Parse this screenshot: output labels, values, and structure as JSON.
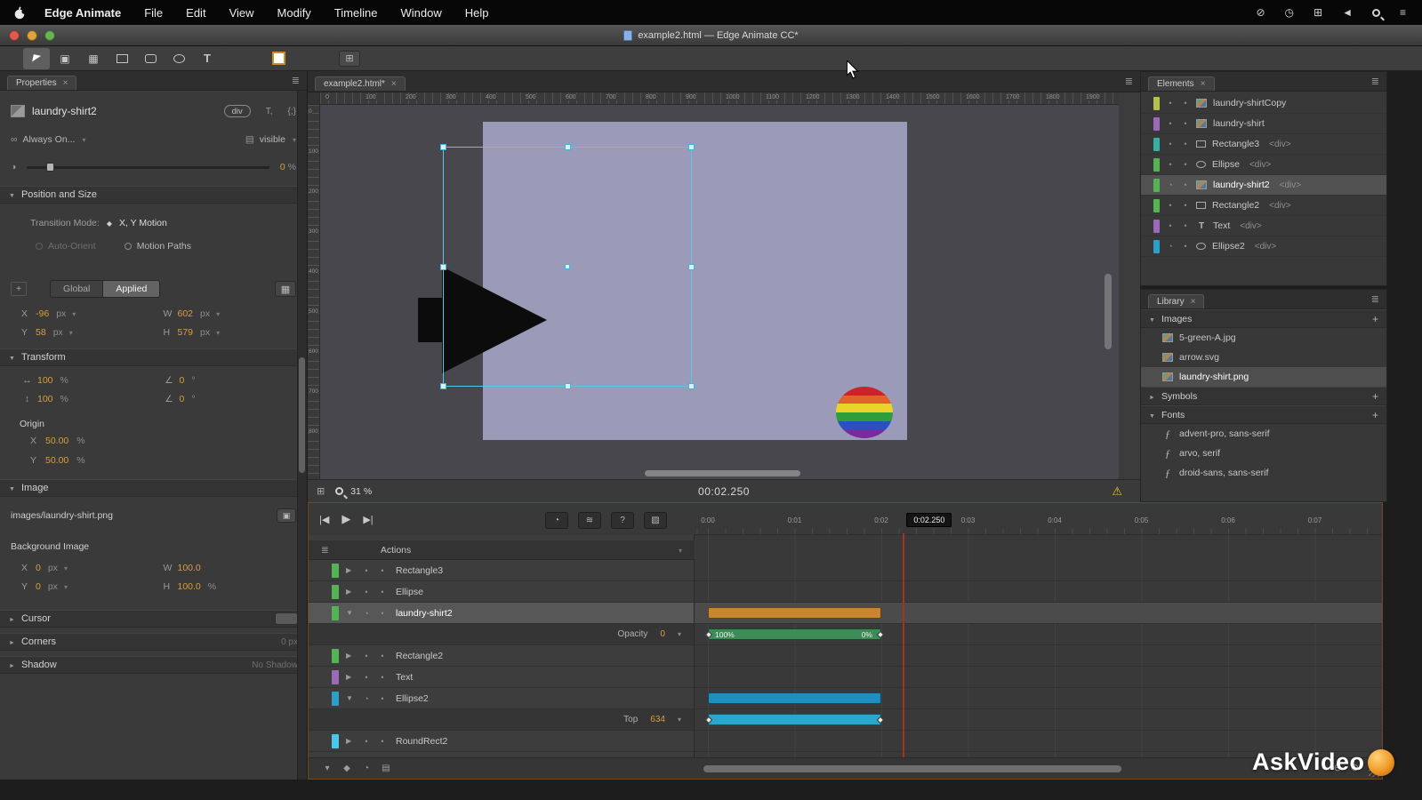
{
  "menubar": {
    "app_name": "Edge Animate",
    "items": [
      "File",
      "Edit",
      "View",
      "Modify",
      "Timeline",
      "Window",
      "Help"
    ],
    "status_icons": [
      "time-machine-icon",
      "clock-icon",
      "displays-icon",
      "volume-icon",
      "spotlight-icon",
      "notification-list-icon"
    ]
  },
  "titlebar": {
    "title": "example2.html — Edge Animate CC*"
  },
  "toolbar": {
    "tools": [
      "select-tool",
      "transform-tool",
      "clip-tool",
      "rectangle-tool",
      "rounded-rect-tool",
      "ellipse-tool",
      "text-tool"
    ]
  },
  "properties": {
    "tab_label": "Properties",
    "element_id": "laundry-shirt2",
    "tag_chip": "div",
    "display_value": "Always On...",
    "overflow_value": "visible",
    "opacity_value": "0",
    "opacity_unit": "%",
    "labels": {
      "x": "X",
      "y": "Y",
      "w": "W",
      "h": "H"
    },
    "position_size": {
      "header": "Position and Size",
      "transition_mode_label": "Transition Mode:",
      "transition_mode_value": "X, Y Motion",
      "auto_orient": "Auto-Orient",
      "motion_paths": "Motion Paths",
      "global": "Global",
      "applied": "Applied",
      "x": "-96",
      "y": "58",
      "w": "602",
      "h": "579",
      "unit": "px"
    },
    "transform": {
      "header": "Transform",
      "scale_x": "100",
      "scale_y": "100",
      "scale_unit": "%",
      "rotate": "0",
      "skew": "0",
      "angle_unit": "°",
      "origin_label": "Origin",
      "origin_x": "50.00",
      "origin_y": "50.00",
      "origin_unit": "%"
    },
    "image": {
      "header": "Image",
      "src": "images/laundry-shirt.png",
      "background_label": "Background Image",
      "x": "0",
      "y": "0",
      "xy_unit": "px",
      "w": "100.0",
      "h": "100.0",
      "h_unit": "%"
    },
    "cursor_header": "Cursor",
    "corners_header": "Corners",
    "corners_value": "0 px",
    "shadow_header": "Shadow",
    "shadow_value": "No Shadow"
  },
  "stage": {
    "tab_label": "example2.html*",
    "zoom": "31 %",
    "timecode": "00:02.250",
    "h_ruler": [
      "0",
      "100",
      "200",
      "300",
      "400",
      "500",
      "600",
      "700",
      "800",
      "900",
      "1000",
      "1100",
      "1200",
      "1300",
      "1400",
      "1500",
      "1600",
      "1700",
      "1800",
      "1900"
    ],
    "v_ruler": [
      "0",
      "100",
      "200",
      "300",
      "400",
      "500",
      "600",
      "700",
      "800"
    ]
  },
  "elements": {
    "tab_label": "Elements",
    "rows": [
      {
        "label": "laundry-shirtCopy",
        "tag": "",
        "chip": "#b4c24a",
        "icon": "image",
        "clock": false,
        "selected": false
      },
      {
        "label": "laundry-shirt",
        "tag": "",
        "chip": "#9a6ab8",
        "icon": "image",
        "clock": false,
        "selected": false
      },
      {
        "label": "Rectangle3",
        "tag": "<div>",
        "chip": "#38b0a0",
        "icon": "rect",
        "clock": false,
        "selected": false
      },
      {
        "label": "Ellipse",
        "tag": "<div>",
        "chip": "#54b454",
        "icon": "ellipse",
        "clock": false,
        "selected": false
      },
      {
        "label": "laundry-shirt2",
        "tag": "<div>",
        "chip": "#54b454",
        "icon": "image",
        "clock": true,
        "selected": true
      },
      {
        "label": "Rectangle2",
        "tag": "<div>",
        "chip": "#54b454",
        "icon": "rect",
        "clock": false,
        "selected": false
      },
      {
        "label": "Text",
        "tag": "<div>",
        "chip": "#9a6ab8",
        "icon": "text",
        "clock": false,
        "selected": false
      },
      {
        "label": "Ellipse2",
        "tag": "<div>",
        "chip": "#2aa0c8",
        "icon": "ellipse",
        "clock": true,
        "selected": false
      }
    ]
  },
  "library": {
    "tab_label": "Library",
    "sections": [
      {
        "label": "Images",
        "expanded": true,
        "items": [
          {
            "name": "5-green-A.jpg",
            "icon": "image",
            "selected": false
          },
          {
            "name": "arrow.svg",
            "icon": "image",
            "selected": false
          },
          {
            "name": "laundry-shirt.png",
            "icon": "image",
            "selected": true
          }
        ]
      },
      {
        "label": "Symbols",
        "expanded": false,
        "items": []
      },
      {
        "label": "Fonts",
        "expanded": true,
        "items": [
          {
            "name": "advent-pro, sans-serif",
            "icon": "font",
            "selected": false
          },
          {
            "name": "arvo, serif",
            "icon": "font",
            "selected": false
          },
          {
            "name": "droid-sans, sans-serif",
            "icon": "font",
            "selected": false
          }
        ]
      }
    ]
  },
  "timeline": {
    "actions_label": "Actions",
    "ruler_labels": [
      "0:00",
      "0:01",
      "0:02",
      "0:03",
      "0:04",
      "0:05",
      "0:06",
      "0:07"
    ],
    "playhead_time": "0:02.250",
    "playhead_seconds": 2.25,
    "rows": [
      {
        "label": "Rectangle3",
        "type": "main",
        "chip": "#54b454",
        "expanded": false,
        "clock": false,
        "selected": false
      },
      {
        "label": "Ellipse",
        "type": "main",
        "chip": "#54b454",
        "expanded": false,
        "clock": false,
        "selected": false
      },
      {
        "label": "laundry-shirt2",
        "type": "main",
        "chip": "#54b454",
        "expanded": true,
        "clock": true,
        "selected": true,
        "bar": {
          "color": "#c8862e",
          "start": 0,
          "end": 2
        }
      },
      {
        "label": "Opacity",
        "type": "sub",
        "value": "0",
        "bar": {
          "color": "#3d8b57",
          "start": 0,
          "end": 2,
          "left_label": "100%",
          "right_label": "0%",
          "keyframes": true
        }
      },
      {
        "label": "Rectangle2",
        "type": "main",
        "chip": "#54b454",
        "expanded": false,
        "clock": false,
        "selected": false
      },
      {
        "label": "Text",
        "type": "main",
        "chip": "#9a6ab8",
        "expanded": false,
        "clock": false,
        "selected": false
      },
      {
        "label": "Ellipse2",
        "type": "main",
        "chip": "#2aa0c8",
        "expanded": true,
        "clock": true,
        "selected": false,
        "bar": {
          "color": "#1f8fbf",
          "start": 0,
          "end": 2
        }
      },
      {
        "label": "Top",
        "type": "sub",
        "value": "634",
        "bar": {
          "color": "#28a8cc",
          "start": 0,
          "end": 2,
          "keyframes": true
        }
      },
      {
        "label": "RoundRect2",
        "type": "main",
        "chip": "#4ac8e8",
        "expanded": false,
        "clock": false,
        "selected": false
      }
    ]
  },
  "watermark": "AskVideo",
  "colors": {
    "accent": "#d79f3c",
    "selection": "#56c8e8",
    "stage_bg": "#9b9bb9",
    "playhead": "#a63322"
  }
}
